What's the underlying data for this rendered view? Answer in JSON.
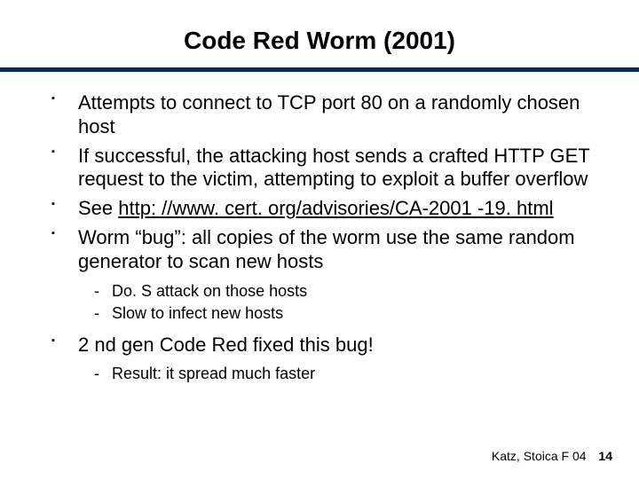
{
  "title": "Code Red Worm (2001)",
  "bullets": {
    "b1": "Attempts to connect to TCP port 80 on a randomly chosen host",
    "b2": "If successful, the attacking host sends a crafted HTTP GET request to the victim, attempting to exploit a buffer overflow",
    "b3_prefix": "See ",
    "b3_link": "http: //www. cert. org/advisories/CA-2001 -19. html",
    "b4": "Worm “bug”: all copies of the worm use the same random generator to scan new hosts",
    "b4_sub1": "Do. S attack on those hosts",
    "b4_sub2": "Slow to infect new hosts",
    "b5": "2 nd gen Code Red fixed this bug!",
    "b5_sub1": "Result: it spread much faster"
  },
  "footer": {
    "credit": "Katz, Stoica F 04",
    "page": "14"
  }
}
